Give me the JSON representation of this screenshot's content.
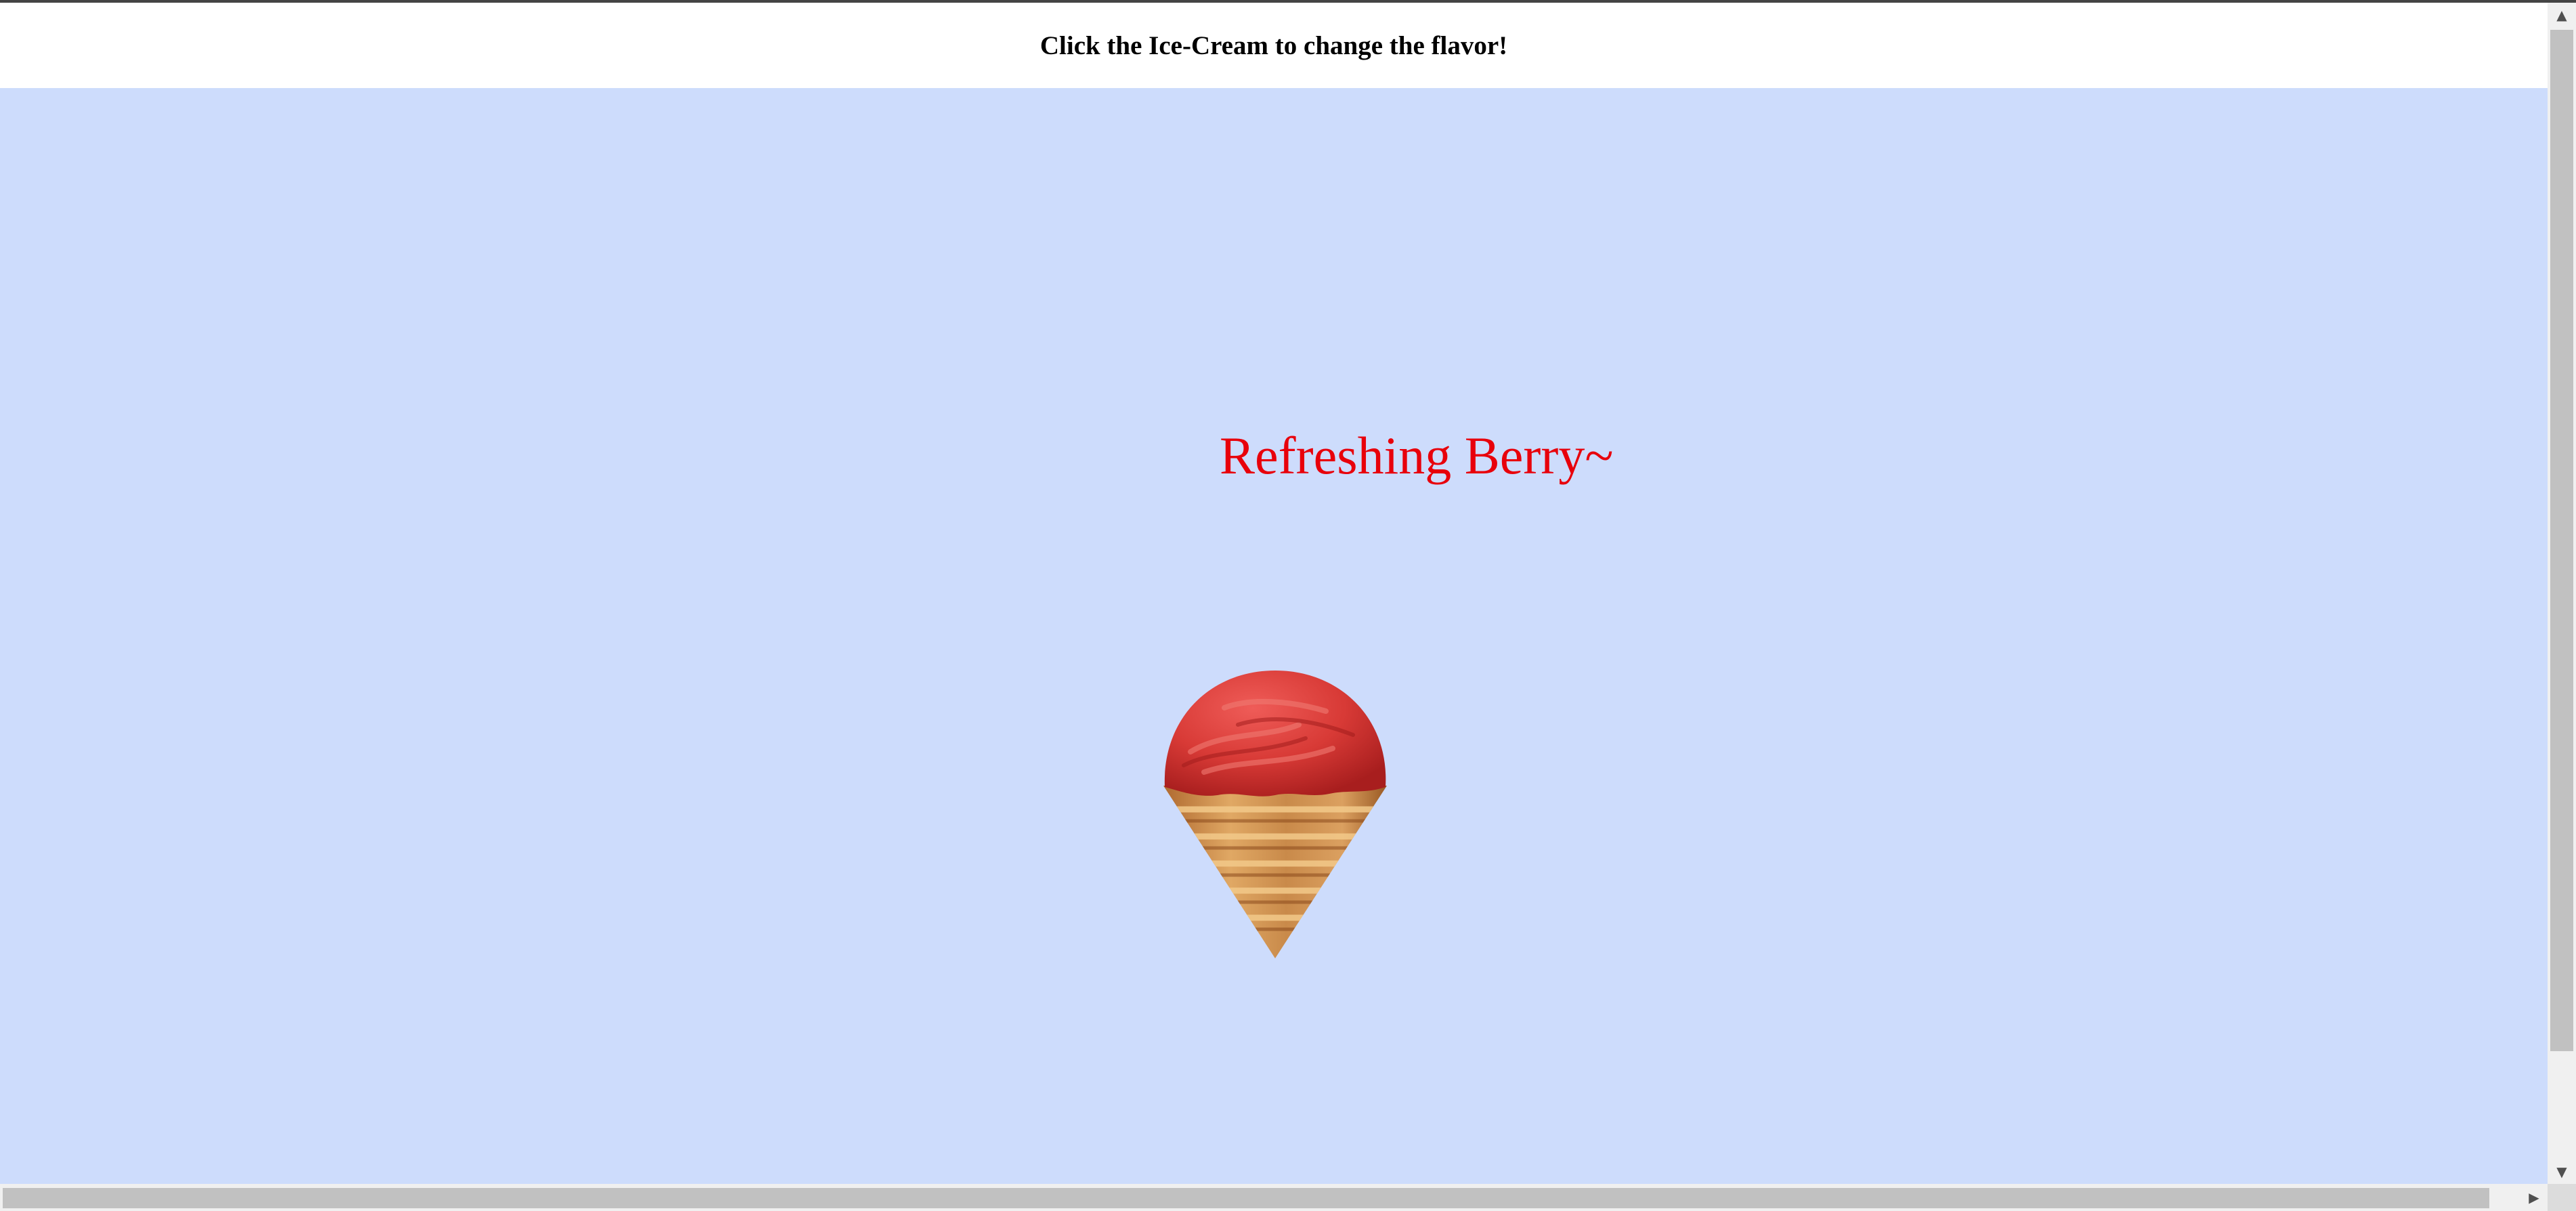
{
  "header": {
    "instruction": "Click the Ice-Cream to change the flavor!"
  },
  "flavor": {
    "label": "Refreshing Berry~",
    "color": "#e8000b"
  },
  "icecream": {
    "icon": "ice-cream-cone-icon",
    "scoop_color": "#d83a36",
    "cone_color": "#c98a4a"
  },
  "colors": {
    "stage_background": "#cddcfc",
    "header_background": "#ffffff"
  },
  "scrollbars": {
    "up_glyph": "▲",
    "down_glyph": "▼",
    "right_glyph": "▶"
  }
}
